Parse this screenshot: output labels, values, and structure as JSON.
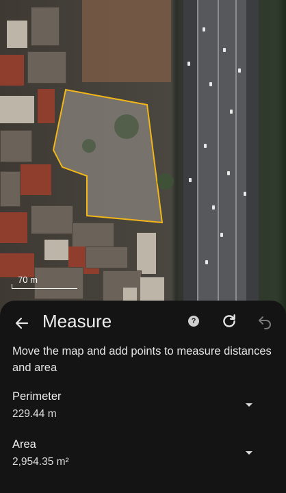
{
  "map": {
    "scale_label": "70 m",
    "polygon_color": "#f2b619"
  },
  "panel": {
    "title": "Measure",
    "back_icon": "arrow-left-icon",
    "help_icon": "help-circle-icon",
    "help_glyph": "?",
    "refresh_icon": "refresh-icon",
    "undo_icon": "undo-icon",
    "description": "Move the map and add points to measure distances and area",
    "perimeter": {
      "label": "Perimeter",
      "value": "229.44 m"
    },
    "area": {
      "label": "Area",
      "value": "2,954.35 m²"
    }
  }
}
